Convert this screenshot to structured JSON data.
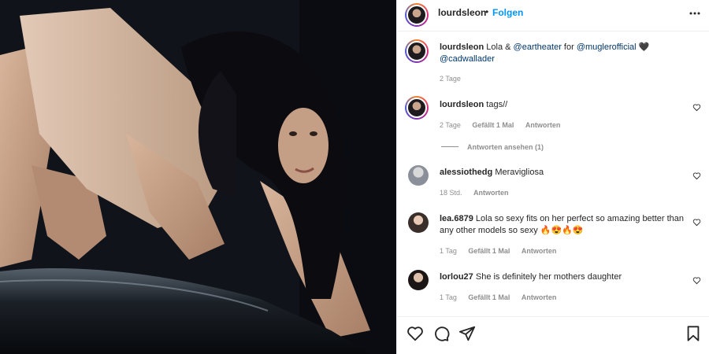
{
  "header": {
    "username": "lourdsleon",
    "separator": "•",
    "follow_label": "Folgen",
    "more_icon": "more-horizontal-icon"
  },
  "caption": {
    "username": "lourdsleon",
    "text_start": "Lola & ",
    "mention1": "@eartheater",
    "text_mid": " for ",
    "mention2": "@muglerofficial",
    "emoji": "🖤",
    "mention3": "@cadwallader",
    "time": "2 Tage"
  },
  "comments": [
    {
      "username": "lourdsleon",
      "text": "tags//",
      "time": "2 Tage",
      "likes": "Gefällt 1 Mal",
      "reply": "Antworten",
      "view_replies": "Antworten ansehen (1)"
    },
    {
      "username": "alessiothedg",
      "text": "Meravigliosa",
      "time": "18 Std.",
      "reply": "Antworten"
    },
    {
      "username": "lea.6879",
      "text": "Lola so sexy fits on her perfect so amazing better than any other models so sexy 🔥😍🔥😍",
      "time": "1 Tag",
      "likes": "Gefällt 1 Mal",
      "reply": "Antworten"
    },
    {
      "username": "lorlou27",
      "text": "She is definitely her mothers daughter",
      "time": "1 Tag",
      "likes": "Gefällt 1 Mal",
      "reply": "Antworten"
    }
  ],
  "actions": {
    "like_icon": "heart-icon",
    "comment_icon": "comment-icon",
    "share_icon": "share-icon",
    "save_icon": "bookmark-icon"
  },
  "colors": {
    "link": "#0095f6",
    "mention": "#00376b",
    "muted": "#8e8e8e",
    "text": "#262626"
  }
}
